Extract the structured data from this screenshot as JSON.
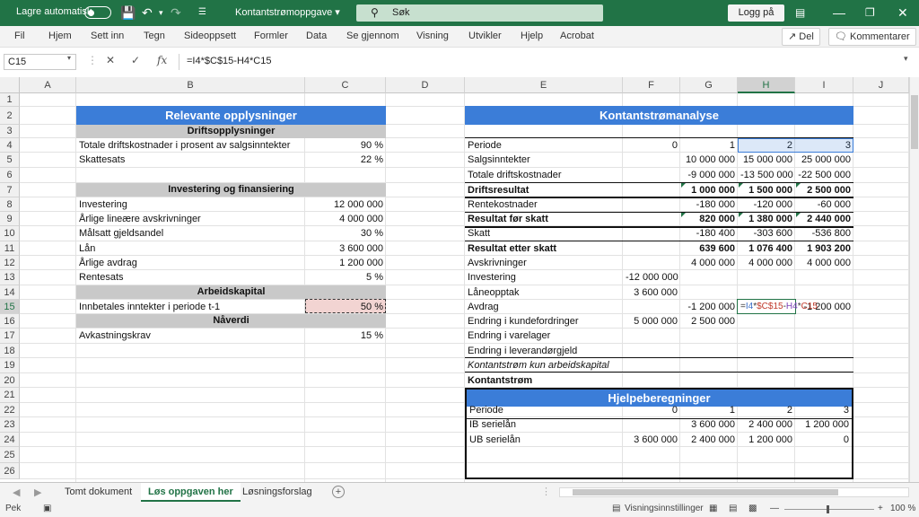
{
  "titlebar": {
    "autosave_label": "Lagre automatisk",
    "doc_title": "Kontantstrømoppgave",
    "search_placeholder": "Søk",
    "login_label": "Logg på"
  },
  "menu": {
    "items": [
      "Fil",
      "Hjem",
      "Sett inn",
      "Tegn",
      "Sideoppsett",
      "Formler",
      "Data",
      "Se gjennom",
      "Visning",
      "Utvikler",
      "Hjelp",
      "Acrobat"
    ],
    "share_label": "Del",
    "comments_label": "Kommentarer"
  },
  "formula_bar": {
    "name_box": "C15",
    "formula": "=I4*$C$15-H4*C15"
  },
  "columns": [
    "A",
    "B",
    "C",
    "D",
    "E",
    "F",
    "G",
    "H",
    "I",
    "J"
  ],
  "rows": [
    "1",
    "2",
    "3",
    "4",
    "5",
    "6",
    "7",
    "8",
    "9",
    "10",
    "11",
    "12",
    "13",
    "14",
    "15",
    "16",
    "17",
    "18",
    "19",
    "20",
    "21",
    "22",
    "23",
    "24",
    "25",
    "26"
  ],
  "left": {
    "title": "Relevante opplysninger",
    "sec_drift": "Driftsopplysninger",
    "r4_label": "Totale driftskostnader i prosent av salgsinntekter",
    "r4_value": "90 %",
    "r5_label": "Skattesats",
    "r5_value": "22 %",
    "sec_invest": "Investering og finansiering",
    "r8_label": "Investering",
    "r8_value": "12 000 000",
    "r9_label": "Årlige lineære avskrivninger",
    "r9_value": "4 000 000",
    "r10_label": "Målsatt gjeldsandel",
    "r10_value": "30 %",
    "r11_label": "Lån",
    "r11_value": "3 600 000",
    "r12_label": "Årlige avdrag",
    "r12_value": "1 200 000",
    "r13_label": "Rentesats",
    "r13_value": "5 %",
    "sec_arb": "Arbeidskapital",
    "r15_label": "Innbetales inntekter i periode t-1",
    "r15_value": "50 %",
    "sec_nav": "Nåverdi",
    "r17_label": "Avkastningskrav",
    "r17_value": "15 %"
  },
  "right": {
    "title": "Kontantstrømanalyse",
    "rows": [
      {
        "label": "Periode",
        "f": "0",
        "g": "1",
        "h": "2",
        "i": "3"
      },
      {
        "label": "Salgsinntekter",
        "f": "",
        "g": "10 000 000",
        "h": "15 000 000",
        "i": "25 000 000"
      },
      {
        "label": "Totale driftskostnader",
        "f": "",
        "g": "-9 000 000",
        "h": "-13 500 000",
        "i": "-22 500 000"
      },
      {
        "label": "Driftsresultat",
        "f": "",
        "g": "1 000 000",
        "h": "1 500 000",
        "i": "2 500 000"
      },
      {
        "label": "Rentekostnader",
        "f": "",
        "g": "-180 000",
        "h": "-120 000",
        "i": "-60 000"
      },
      {
        "label": "Resultat før skatt",
        "f": "",
        "g": "820 000",
        "h": "1 380 000",
        "i": "2 440 000"
      },
      {
        "label": "Skatt",
        "f": "",
        "g": "-180 400",
        "h": "-303 600",
        "i": "-536 800"
      },
      {
        "label": "Resultat etter skatt",
        "f": "",
        "g": "639 600",
        "h": "1 076 400",
        "i": "1 903 200"
      },
      {
        "label": "Avskrivninger",
        "f": "",
        "g": "4 000 000",
        "h": "4 000 000",
        "i": "4 000 000"
      },
      {
        "label": "Investering",
        "f": "-12 000 000",
        "g": "",
        "h": "",
        "i": ""
      },
      {
        "label": "Låneopptak",
        "f": "3 600 000",
        "g": "",
        "h": "",
        "i": ""
      },
      {
        "label": "Avdrag",
        "f": "",
        "g": "-1 200 000",
        "h": "-1 200 000",
        "i": "-1 200 000"
      },
      {
        "label": "Endring i kundefordringer",
        "f": "5 000 000",
        "g": "2 500 000",
        "h": "",
        "i": ""
      },
      {
        "label": "Endring i varelager",
        "f": "",
        "g": "",
        "h": "",
        "i": ""
      },
      {
        "label": "Endring i leverandørgjeld",
        "f": "",
        "g": "",
        "h": "",
        "i": ""
      },
      {
        "label": "Kontantstrøm kun arbeidskapital",
        "f": "",
        "g": "",
        "h": "",
        "i": ""
      },
      {
        "label": "Kontantstrøm",
        "f": "",
        "g": "",
        "h": "",
        "i": ""
      }
    ],
    "edit_formula_parts": [
      "=",
      "I4",
      "*",
      "$C$15",
      "-",
      "H4",
      "*",
      "C15"
    ],
    "helper_title": "Hjelpeberegninger",
    "helper_rows": [
      {
        "label": "Periode",
        "f": "0",
        "g": "1",
        "h": "2",
        "i": "3"
      },
      {
        "label": "IB serielån",
        "f": "",
        "g": "3 600 000",
        "h": "2 400 000",
        "i": "1 200 000"
      },
      {
        "label": "UB serielån",
        "f": "3 600 000",
        "g": "2 400 000",
        "h": "1 200 000",
        "i": "0"
      }
    ]
  },
  "sheets": {
    "tabs": [
      "Tomt dokument",
      "Løs oppgaven her",
      "Løsningsforslag"
    ],
    "active": "Løs oppgaven her"
  },
  "status": {
    "mode": "Pek",
    "view_settings": "Visningsinnstillinger",
    "zoom": "100 %"
  },
  "colors": {
    "excel_green": "#217346",
    "blue_header": "#3b7dd8",
    "gray_header": "#c9c9c9"
  }
}
